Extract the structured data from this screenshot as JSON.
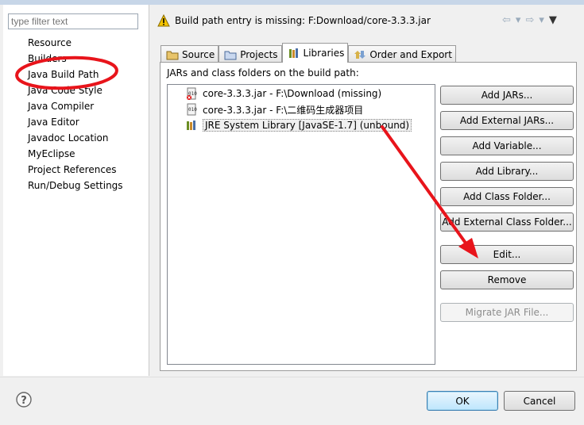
{
  "filter": {
    "placeholder": "type filter text"
  },
  "tree": [
    "Resource",
    "Builders",
    "Java Build Path",
    "Java Code Style",
    "Java Compiler",
    "Java Editor",
    "Javadoc Location",
    "MyEclipse",
    "Project References",
    "Run/Debug Settings"
  ],
  "header": {
    "message": "Build path entry is missing: F:Download/core-3.3.3.jar"
  },
  "tabs": [
    "Source",
    "Projects",
    "Libraries",
    "Order and Export"
  ],
  "panel": {
    "label": "JARs and class folders on the build path:"
  },
  "entries": [
    {
      "label": "core-3.3.3.jar - F:\\Download (missing)",
      "icon": "missing-jar-icon"
    },
    {
      "label": "core-3.3.3.jar - F:\\二维码生成器项目",
      "icon": "jar-icon"
    },
    {
      "label": "JRE System Library [JavaSE-1.7] (unbound)",
      "icon": "library-icon"
    }
  ],
  "buttons": {
    "add_jars": "Add JARs...",
    "add_external_jars": "Add External JARs...",
    "add_variable": "Add Variable...",
    "add_library": "Add Library...",
    "add_class_folder": "Add Class Folder...",
    "add_external_class_folder": "Add External Class Folder...",
    "edit": "Edit...",
    "remove": "Remove",
    "migrate": "Migrate JAR File..."
  },
  "footer": {
    "ok": "OK",
    "cancel": "Cancel"
  },
  "colors": {
    "annotation": "#e8141b",
    "accent": "#3c7fb1"
  }
}
